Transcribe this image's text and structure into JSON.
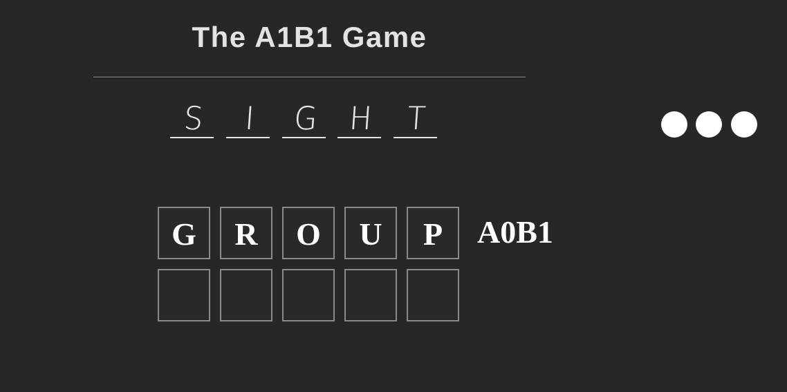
{
  "title": "The A1B1 Game",
  "target_word": {
    "letters": [
      "S",
      "I",
      "G",
      "H",
      "T"
    ]
  },
  "menu": {
    "icon": "more-dots-icon"
  },
  "guesses": [
    {
      "letters": [
        "G",
        "R",
        "O",
        "U",
        "P"
      ],
      "result": "A0B1"
    },
    {
      "letters": [
        "",
        "",
        "",
        "",
        ""
      ],
      "result": ""
    }
  ],
  "colors": {
    "background": "#272727",
    "text": "#ffffff",
    "cell_border": "#8a8a8a"
  }
}
